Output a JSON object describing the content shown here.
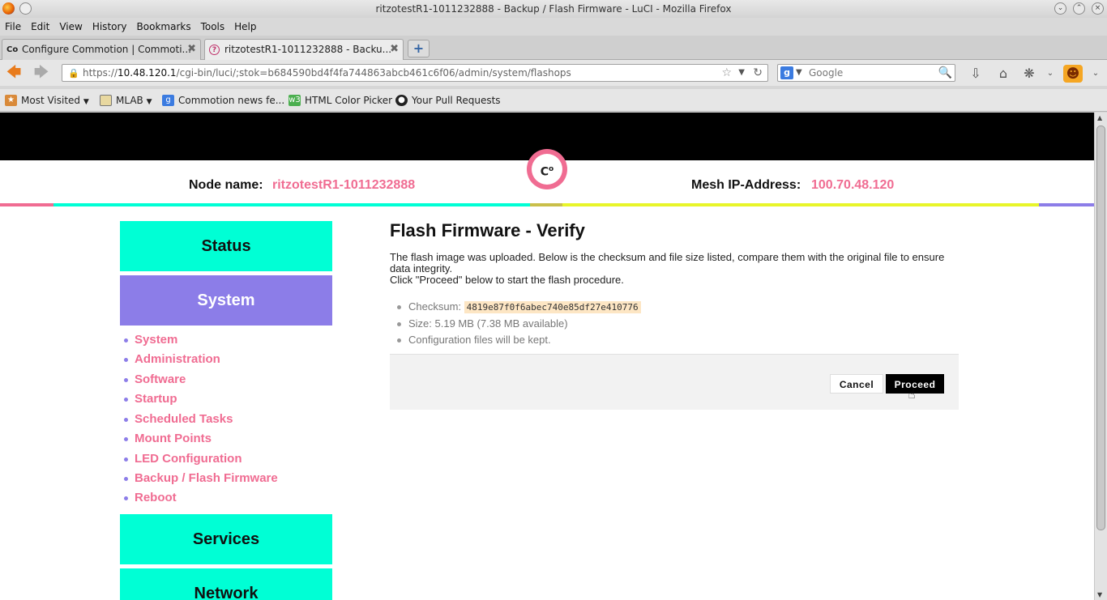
{
  "window": {
    "title": "ritzotestR1-1011232888 - Backup / Flash Firmware - LuCI - Mozilla Firefox"
  },
  "menubar": [
    "File",
    "Edit",
    "View",
    "History",
    "Bookmarks",
    "Tools",
    "Help"
  ],
  "tabs": [
    {
      "label": "Configure Commotion | Commoti...",
      "favicon": "Co",
      "active": false
    },
    {
      "label": "ritzotestR1-1011232888 - Backu...",
      "favicon": "?",
      "active": true
    }
  ],
  "urlbar": {
    "scheme": "https://",
    "host": "10.48.120.1",
    "path": "/cgi-bin/luci/;stok=b684590bd4f4fa744863abcb461c6f06/admin/system/flashops"
  },
  "search": {
    "placeholder": "Google"
  },
  "bookmarks": [
    {
      "label": "Most Visited",
      "icon": "bookmark-star-icon",
      "dropdown": true
    },
    {
      "label": "MLAB",
      "icon": "folder-icon",
      "dropdown": true
    },
    {
      "label": "Commotion news fe...",
      "icon": "google-icon",
      "dropdown": false
    },
    {
      "label": "HTML Color Picker",
      "icon": "w3-icon",
      "dropdown": false
    },
    {
      "label": "Your Pull Requests",
      "icon": "github-icon",
      "dropdown": false
    }
  ],
  "header": {
    "logo_text": "C",
    "logo_sup": "o",
    "node_name_label": "Node name:",
    "node_name_value": "ritzotestR1-1011232888",
    "mesh_ip_label": "Mesh IP-Address:",
    "mesh_ip_value": "100.70.48.120"
  },
  "colors": {
    "pink": "#f06c92",
    "teal": "#00ffd5",
    "purple": "#8c7de8",
    "yellow": "#e8f52a",
    "olive": "#c9bf4a"
  },
  "sidebar": {
    "status_label": "Status",
    "system_label": "System",
    "submenu": [
      "System",
      "Administration",
      "Software",
      "Startup",
      "Scheduled Tasks",
      "Mount Points",
      "LED Configuration",
      "Backup / Flash Firmware",
      "Reboot"
    ],
    "services_label": "Services",
    "network_label": "Network"
  },
  "main": {
    "title": "Flash Firmware - Verify",
    "intro_line1": "The flash image was uploaded. Below is the checksum and file size listed, compare them with the original file to ensure data integrity.",
    "intro_line2": "Click \"Proceed\" below to start the flash procedure.",
    "checksum_label": "Checksum:",
    "checksum_value": "4819e87f0f6abec740e85df27e410776",
    "size_text": "Size: 5.19 MB (7.38 MB available)",
    "config_text": "Configuration files will be kept.",
    "cancel_label": "Cancel",
    "proceed_label": "Proceed"
  }
}
